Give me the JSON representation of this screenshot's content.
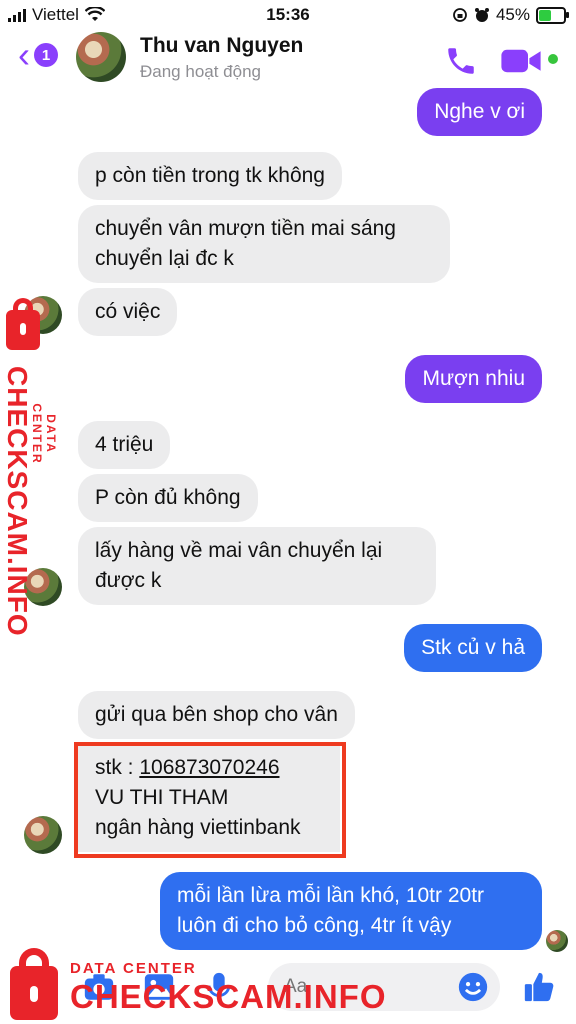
{
  "status_bar": {
    "carrier": "Viettel",
    "time": "15:36",
    "battery_percent": "45%",
    "battery_level": 0.45
  },
  "header": {
    "back_badge": "1",
    "contact_name": "Thu van Nguyen",
    "presence": "Đang hoạt động",
    "colors": {
      "accent": "#8a3ffc",
      "online": "#37c53d"
    }
  },
  "messages": [
    {
      "side": "out",
      "text": "Nghe v ơi"
    },
    {
      "side": "in",
      "text": "p còn tiền trong tk không"
    },
    {
      "side": "in",
      "text": "chuyển vân mượn tiền mai sáng"
    },
    {
      "side": "in",
      "text": "chuyển lại đc k"
    },
    {
      "side": "in",
      "text": "có việc"
    },
    {
      "side": "out",
      "text": "Mượn nhiu"
    },
    {
      "side": "in",
      "text": "4 triệu"
    },
    {
      "side": "in",
      "text": "P còn đủ không"
    },
    {
      "side": "in",
      "text": "lấy hàng về mai vân chuyển lại"
    },
    {
      "side": "in",
      "text": "được k"
    },
    {
      "side": "out",
      "text": "Stk củ v hả"
    },
    {
      "side": "in",
      "text": "gửi qua bên shop cho vân"
    },
    {
      "side": "in",
      "prefix": "stk : ",
      "account_number": "106873070246",
      "account_name": "VU THI THAM",
      "bank": "ngân hàng viettinbank"
    },
    {
      "side": "out",
      "text": "mỗi lần lừa mỗi lần khó, 10tr 20tr"
    },
    {
      "side": "out",
      "text": "luôn đi cho bỏ công, 4tr ít vậy"
    }
  ],
  "composer": {
    "placeholder": "Aa"
  },
  "watermark": {
    "sub": "DATA CENTER",
    "main": "CHECKSCAM.INFO",
    "color": "#e8242a"
  },
  "icons": [
    "signal-icon",
    "wifi-icon",
    "orientation-lock-icon",
    "alarm-icon",
    "battery-icon",
    "back-chevron-icon",
    "phone-icon",
    "video-icon",
    "camera-icon",
    "photo-icon",
    "mic-icon",
    "emoji-icon",
    "like-icon",
    "lock-icon"
  ],
  "colors": {
    "out_purple": "#7a3ff0",
    "out_blue": "#2f6ff0",
    "incoming": "#ececed",
    "highlight_box": "#ee3a20"
  }
}
